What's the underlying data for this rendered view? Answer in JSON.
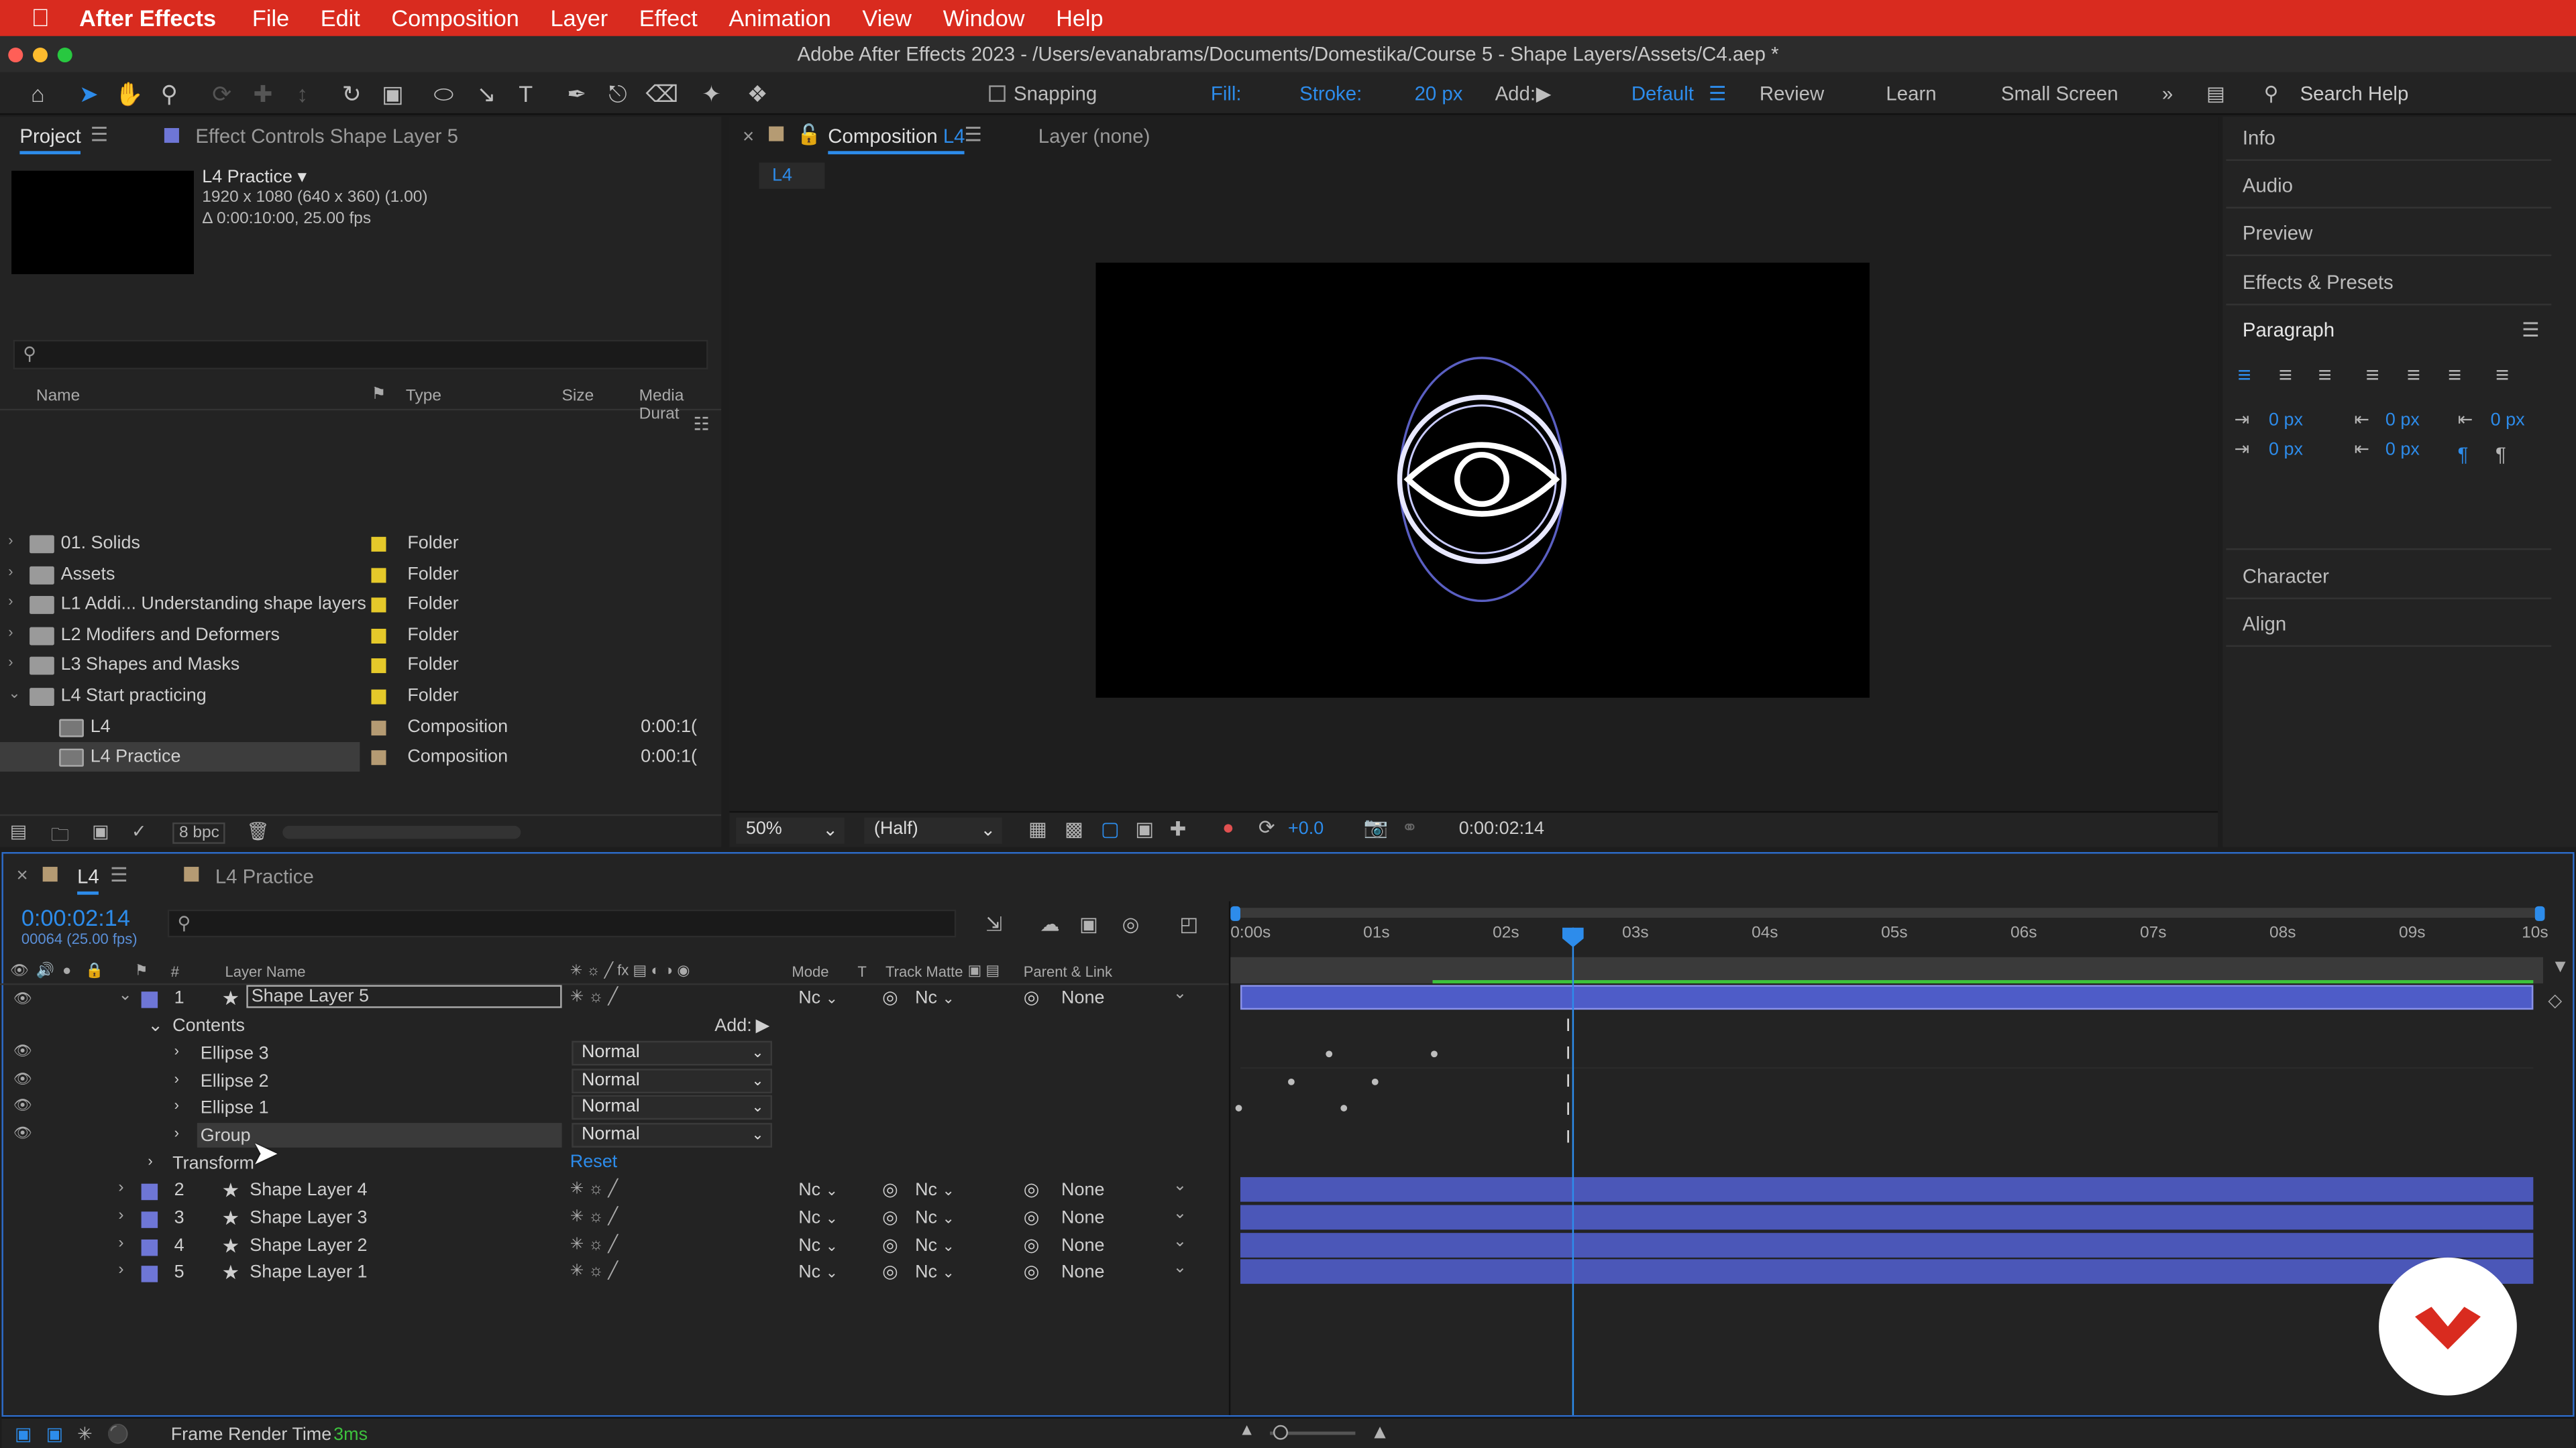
{
  "menubar": {
    "app": "After Effects",
    "items": [
      "File",
      "Edit",
      "Composition",
      "Layer",
      "Effect",
      "Animation",
      "View",
      "Window",
      "Help"
    ]
  },
  "window_title": "Adobe After Effects 2023 - /Users/evanabrams/Documents/Domestika/Course 5 - Shape Layers/Assets/C4.aep *",
  "toolbar": {
    "snapping": "Snapping",
    "fill": "Fill:",
    "stroke": "Stroke:",
    "stroke_width": "20 px",
    "add": "Add:",
    "workspaces": [
      "Default",
      "Review",
      "Learn",
      "Small Screen"
    ],
    "search_placeholder": "Search Help"
  },
  "project_panel": {
    "tab_project": "Project",
    "tab_effect_controls": "Effect Controls Shape Layer 5",
    "comp_name": "L4 Practice ▾",
    "comp_info1": "1920 x 1080  (640 x 360) (1.00)",
    "comp_info2": "Δ 0:00:10:00, 25.00 fps",
    "columns": {
      "name": "Name",
      "type": "Type",
      "size": "Size",
      "media": "Media Durat"
    },
    "items": [
      {
        "name": "01. Solids",
        "type": "Folder",
        "dur": "",
        "color": "#e5c92a",
        "kind": "folder",
        "arrow": "›",
        "indent": 0
      },
      {
        "name": "Assets",
        "type": "Folder",
        "dur": "",
        "color": "#e5c92a",
        "kind": "folder",
        "arrow": "›",
        "indent": 0
      },
      {
        "name": "L1 Addi... Understanding shape layers",
        "type": "Folder",
        "dur": "",
        "color": "#e5c92a",
        "kind": "folder",
        "arrow": "›",
        "indent": 0
      },
      {
        "name": "L2 Modifers and Deformers",
        "type": "Folder",
        "dur": "",
        "color": "#e5c92a",
        "kind": "folder",
        "arrow": "›",
        "indent": 0
      },
      {
        "name": "L3 Shapes and Masks",
        "type": "Folder",
        "dur": "",
        "color": "#e5c92a",
        "kind": "folder",
        "arrow": "›",
        "indent": 0
      },
      {
        "name": "L4 Start practicing",
        "type": "Folder",
        "dur": "",
        "color": "#e5c92a",
        "kind": "folder",
        "arrow": "⌄",
        "indent": 0
      },
      {
        "name": "L4",
        "type": "Composition",
        "dur": "0:00:1(",
        "color": "#b59b73",
        "kind": "comp",
        "arrow": "",
        "indent": 1
      },
      {
        "name": "L4 Practice",
        "type": "Composition",
        "dur": "0:00:1(",
        "color": "#b59b73",
        "kind": "comp",
        "arrow": "",
        "indent": 1
      }
    ],
    "bpc": "8 bpc"
  },
  "composition_panel": {
    "tab": "Composition",
    "tab_comp": "L4",
    "layer_tab": "Layer (none)",
    "sub_tab": "L4",
    "zoom": "50%",
    "resolution": "(Half)",
    "exposure": "+0.0",
    "timecode": "0:00:02:14"
  },
  "right_panel": {
    "info": "Info",
    "audio": "Audio",
    "preview": "Preview",
    "effects": "Effects & Presets",
    "paragraph": "Paragraph",
    "indent_values": [
      "0 px",
      "0 px",
      "0 px",
      "0 px",
      "0 px"
    ],
    "character": "Character",
    "align": "Align"
  },
  "timeline": {
    "tab_l4": "L4",
    "tab_practice": "L4 Practice",
    "timecode": "0:00:02:14",
    "fps_info": "00064 (25.00 fps)",
    "columns": {
      "layer_name": "Layer Name",
      "mode": "Mode",
      "t": "T",
      "track_matte": "Track Matte",
      "parent": "Parent & Link"
    },
    "layers": [
      {
        "num": "1",
        "name": "Shape Layer 5",
        "mode": "Nc",
        "matte": "Nc",
        "parent": "None"
      },
      {
        "num": "2",
        "name": "Shape Layer 4",
        "mode": "Nc",
        "matte": "Nc",
        "parent": "None"
      },
      {
        "num": "3",
        "name": "Shape Layer 3",
        "mode": "Nc",
        "matte": "Nc",
        "parent": "None"
      },
      {
        "num": "4",
        "name": "Shape Layer 2",
        "mode": "Nc",
        "matte": "Nc",
        "parent": "None"
      },
      {
        "num": "5",
        "name": "Shape Layer 1",
        "mode": "Nc",
        "matte": "Nc",
        "parent": "None"
      }
    ],
    "contents": "Contents",
    "add": "Add:",
    "sub_items": [
      {
        "name": "Ellipse 3",
        "mode": "Normal"
      },
      {
        "name": "Ellipse 2",
        "mode": "Normal"
      },
      {
        "name": "Ellipse 1",
        "mode": "Normal"
      },
      {
        "name": "Group",
        "mode": "Normal"
      }
    ],
    "transform": "Transform",
    "reset": "Reset",
    "ruler": [
      "0:00s",
      "01s",
      "02s",
      "03s",
      "04s",
      "05s",
      "06s",
      "07s",
      "08s",
      "09s",
      "10s"
    ],
    "frame_render_label": "Frame Render Time",
    "frame_render_value": "3ms"
  }
}
